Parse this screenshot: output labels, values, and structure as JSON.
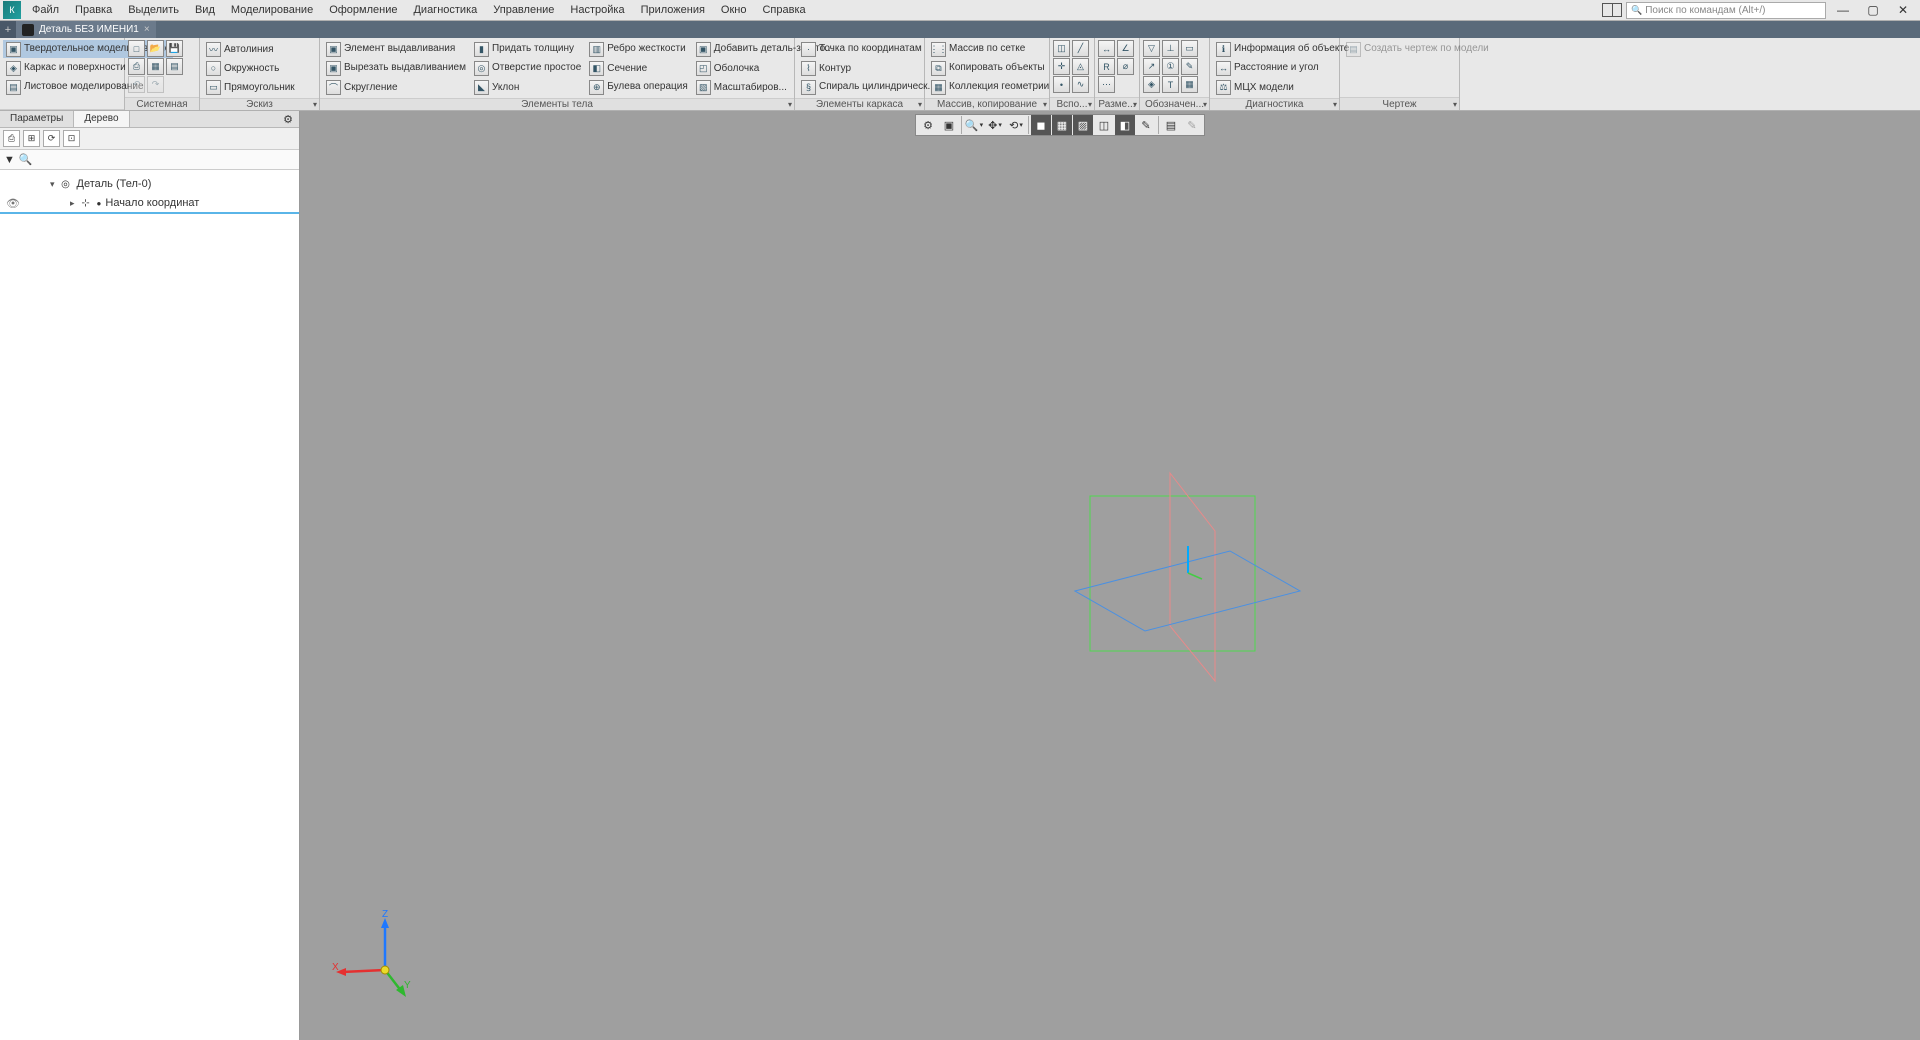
{
  "menu": {
    "items": [
      "Файл",
      "Правка",
      "Выделить",
      "Вид",
      "Моделирование",
      "Оформление",
      "Диагностика",
      "Управление",
      "Настройка",
      "Приложения",
      "Окно",
      "Справка"
    ],
    "search_placeholder": "Поиск по командам (Alt+/)"
  },
  "doc_tab": {
    "title": "Деталь БЕЗ ИМЕНИ1"
  },
  "ribbon": {
    "group_mode": {
      "items": [
        "Твердотельное моделирование",
        "Каркас и поверхности",
        "Листовое моделирование"
      ]
    },
    "group_system": {
      "label": "Системная"
    },
    "group_sketch": {
      "label": "Эскиз",
      "items": [
        "Автолиния",
        "Окружность",
        "Прямоугольник"
      ]
    },
    "group_body": {
      "label": "Элементы тела",
      "c1": [
        "Элемент выдавливания",
        "Вырезать выдавливанием",
        "Скругление"
      ],
      "c2": [
        "Придать толщину",
        "Отверстие простое",
        "Уклон"
      ],
      "c3": [
        "Ребро жесткости",
        "Сечение",
        "Булева операция"
      ],
      "c4": [
        "Добавить деталь-загото...",
        "Оболочка",
        "Масштабиров..."
      ]
    },
    "group_frame": {
      "label": "Элементы каркаса",
      "items": [
        "Точка по координатам",
        "Контур",
        "Спираль цилиндрическ..."
      ]
    },
    "group_array": {
      "label": "Массив, копирование",
      "items": [
        "Массив по сетке",
        "Копировать объекты",
        "Коллекция геометрии"
      ]
    },
    "group_aux": {
      "label": "Вспо..."
    },
    "group_dim": {
      "label": "Разме..."
    },
    "group_sym": {
      "label": "Обозначен..."
    },
    "group_diag": {
      "label": "Диагностика",
      "items": [
        "Информация об объекте",
        "Расстояние и угол",
        "МЦХ модели"
      ]
    },
    "group_draw": {
      "label": "Чертеж",
      "item": "Создать чертеж по модели"
    }
  },
  "side": {
    "tabs": [
      "Параметры",
      "Дерево"
    ],
    "tree_root": "Деталь (Тел-0)",
    "tree_child": "Начало координат"
  },
  "triad": {
    "x": "X",
    "y": "Y",
    "z": "Z"
  }
}
